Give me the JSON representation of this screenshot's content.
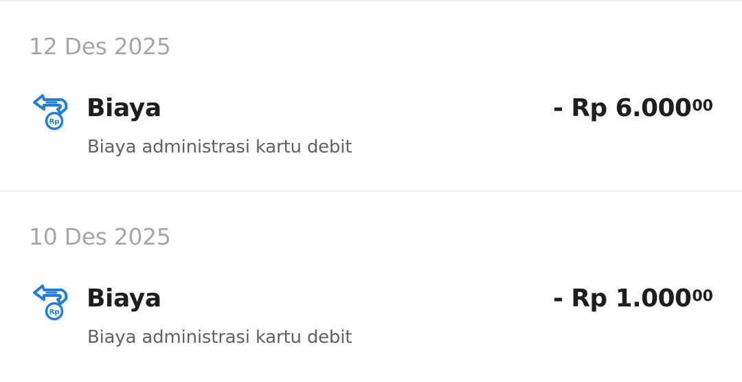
{
  "colors": {
    "icon_blue": "#1e7fe0",
    "date_text": "#a7a5a8",
    "title_text": "#1e1e1e",
    "desc_text": "#616161"
  },
  "groups": [
    {
      "date": "12 Des 2025",
      "transaction": {
        "icon": "fee-coin-icon",
        "title": "Biaya",
        "description": "Biaya administrasi kartu debit",
        "amount_main": "- Rp 6.000",
        "amount_cents": "00"
      }
    },
    {
      "date": "10 Des 2025",
      "transaction": {
        "icon": "fee-coin-icon",
        "title": "Biaya",
        "description": "Biaya administrasi kartu debit",
        "amount_main": "- Rp 1.000",
        "amount_cents": "00"
      }
    }
  ],
  "icon_label": "Rp"
}
